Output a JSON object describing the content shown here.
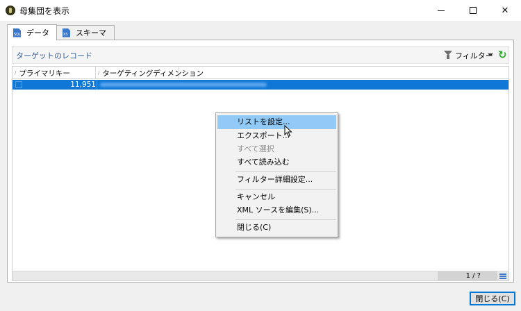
{
  "window": {
    "title": "母集団を表示"
  },
  "tabs": [
    {
      "label": "データ",
      "icon": "sql-document-icon",
      "icon_text": "SQL"
    },
    {
      "label": "スキーマ",
      "icon": "xml-document-icon",
      "icon_text": "XS"
    }
  ],
  "toolbar": {
    "title": "ターゲットのレコード",
    "filter_label": "フィルター",
    "refresh_icon": "refresh-icon"
  },
  "grid": {
    "columns": [
      "プライマリキー",
      "ターゲティングディメンション"
    ],
    "rows": [
      {
        "primary_key": "11,951"
      }
    ],
    "pager": "1 / ?"
  },
  "context_menu": {
    "items": [
      {
        "label": "リストを設定...",
        "highlighted": true
      },
      {
        "label": "エクスポート..."
      },
      {
        "label": "すべて選択",
        "disabled": true
      },
      {
        "label": "すべて読み込む"
      },
      {
        "label": "フィルター詳細設定..."
      },
      {
        "label": "キャンセル"
      },
      {
        "label": "XML ソースを編集(S)..."
      },
      {
        "label": "閉じる(C)"
      }
    ]
  },
  "footer": {
    "close_button": "閉じる(C)"
  },
  "colors": {
    "selection": "#0f78d7",
    "menu_highlight": "#91c9f7",
    "link": "#2e5c9a",
    "accent": "#0078d7"
  }
}
